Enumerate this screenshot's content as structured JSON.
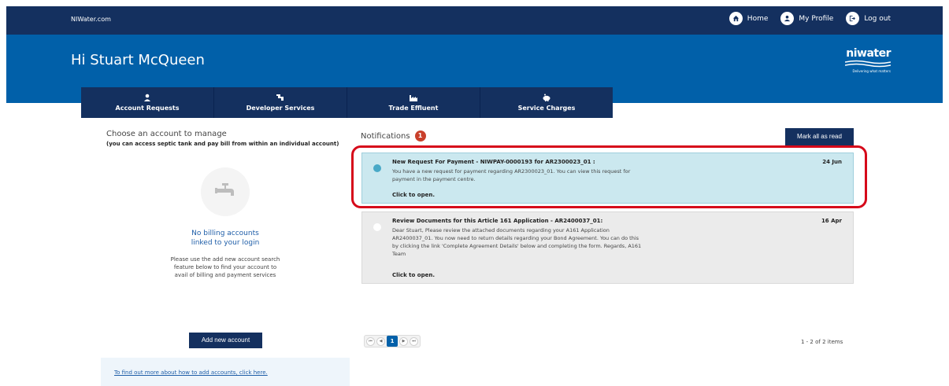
{
  "header": {
    "site": "NIWater.com",
    "nav": [
      {
        "label": "Home",
        "icon": "home-icon"
      },
      {
        "label": "My Profile",
        "icon": "user-icon"
      },
      {
        "label": "Log out",
        "icon": "logout-icon"
      }
    ]
  },
  "banner": {
    "greeting": "Hi Stuart McQueen",
    "logo_word": "niwater",
    "logo_tag": "Delivering what matters"
  },
  "tabs": [
    {
      "label": "Account Requests",
      "icon": "person-icon"
    },
    {
      "label": "Developer Services",
      "icon": "pipe-icon"
    },
    {
      "label": "Trade Effluent",
      "icon": "factory-icon"
    },
    {
      "label": "Service Charges",
      "icon": "piggy-bank-icon"
    }
  ],
  "accounts": {
    "title": "Choose an account to manage",
    "subtitle": "(you can access septic tank and pay bill from within an individual account)",
    "empty_title_line1": "No billing accounts",
    "empty_title_line2": "linked to your login",
    "empty_desc_line1": "Please use the add new account search",
    "empty_desc_line2": "feature below to find your account to",
    "empty_desc_line3": "avail of billing and payment services",
    "add_button": "Add new account",
    "help_link": "To find out more about how to add accounts, click here."
  },
  "notifications": {
    "title": "Notifications",
    "count": "1",
    "mark_all": "Mark all as read",
    "items": [
      {
        "title": "New Request For Payment - NIWPAY-0000193 for AR2300023_01 :",
        "date": "24 Jun",
        "body_line1": "You have a new request for payment regarding AR2300023_01. You can view this request for",
        "body_line2": "payment in the payment centre.",
        "open": "Click to open."
      },
      {
        "title": "Review Documents for this Article 161 Application - AR2400037_01:",
        "date": "16 Apr",
        "body_line1": "Dear Stuart, Please review the attached documents regarding your A161 Application",
        "body_line2": "AR2400037_01. You now need to return details regarding your Bond Agreement. You can do this",
        "body_line3": "by clicking the link 'Complete Agreement Details' below and completing the form. Regards, A161",
        "body_line4": "Team",
        "open": "Click to open."
      }
    ],
    "pager": {
      "current": "1",
      "first": "⏮",
      "prev": "◀",
      "next": "▶",
      "last": "⏭"
    },
    "summary": "1 - 2 of 2 items"
  },
  "colors": {
    "navy": "#14305f",
    "blue": "#0160a9",
    "badge": "#c9402b",
    "highlight": "#d6091a"
  }
}
